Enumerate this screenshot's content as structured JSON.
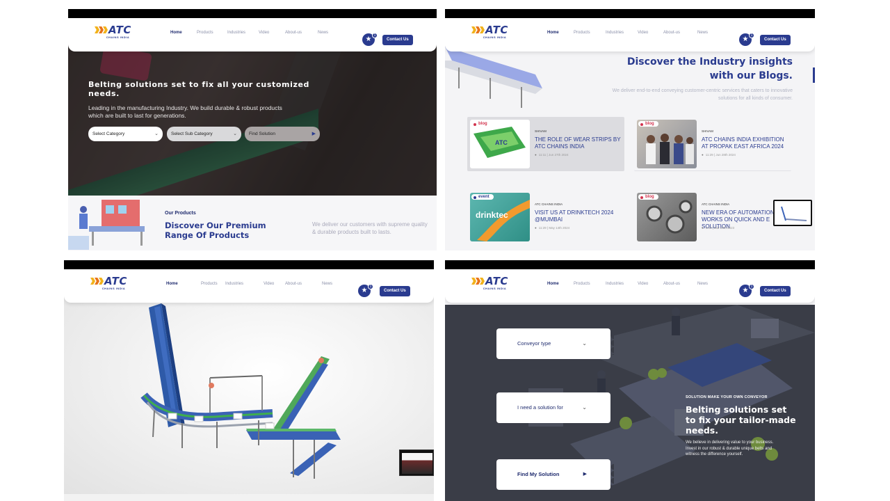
{
  "brand": {
    "name": "ATC",
    "sub": "CHAINS INDIA",
    "accent": "#2a3b8f",
    "logo_yellow": "#f2b21b",
    "logo_orange": "#e8741a"
  },
  "nav": {
    "items": [
      "Home",
      "Products",
      "Industries",
      "Video",
      "About-us",
      "News"
    ],
    "wishlist_count": "1",
    "contact_label": "Contact Us",
    "star_icon": "star-icon"
  },
  "panel1": {
    "hero_title": "Belting solutions set to fix all your customized needs.",
    "hero_desc": "Leading in the manufacturing Industry. We build durable & robust products which are built to last for generations.",
    "select_category": "Select Category",
    "select_subcategory": "Select Sub Category",
    "find_solution": "Find Solution",
    "products_label": "Our Products",
    "products_title": "Discover Our Premium Range Of Products",
    "products_desc": "We deliver our customers with supreme quality & durable products built to lasts."
  },
  "panel2": {
    "title": "Discover the Industry insights with our Blogs.",
    "desc": "We deliver end-to-end conveying customer-centric services that caters to innovative solutions for all kinds of consumer.",
    "cards": [
      {
        "tag": "blog",
        "author": "SHIVAM",
        "title": "THE ROLE OF WEAR STRIPS BY ATC CHAINS INDIA",
        "meta": "11:11 | Jun 27th 2024"
      },
      {
        "tag": "blog",
        "author": "SHIVAM",
        "title": "ATC CHAINS INDIA EXHIBITION AT PROPAK EAST AFRICA 2024",
        "meta": "11:29 | Jun 28th 2024"
      },
      {
        "tag": "event",
        "author": "ATC CHAINS INDIA",
        "title": "VISIT US AT DRINKTECH 2024 @MUMBAI",
        "meta": "11:29 | May 14th 2024",
        "thumb_text": "drinktec"
      },
      {
        "tag": "blog",
        "author": "ATC CHAINS INDIA",
        "title": "NEW ERA OF AUTOMATION WORKS ON QUICK AND E SOLUTION",
        "meta": "6:49 | Mar 20th 2023"
      }
    ]
  },
  "panel4": {
    "conveyor_type": "Conveyor type",
    "need_solution": "I need a solution for",
    "find_solution": "Find My Solution",
    "label": "SOLUTION MAKE YOUR OWN CONVEYOR",
    "title": "Belting solutions set to fix your tailor-made needs.",
    "desc": "We believe in delivering value to your business. Invest in our robust & durable unique belts and witness the difference yourself."
  }
}
